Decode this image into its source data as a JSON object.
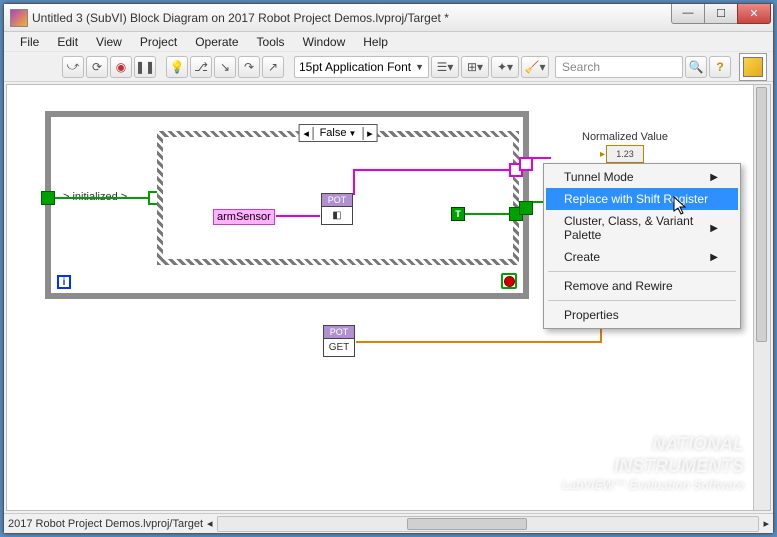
{
  "window": {
    "title": "Untitled 3 (SubVI) Block Diagram on 2017 Robot Project Demos.lvproj/Target *"
  },
  "menu": {
    "items": [
      "File",
      "Edit",
      "View",
      "Project",
      "Operate",
      "Tools",
      "Window",
      "Help"
    ]
  },
  "toolbar": {
    "font_label": "15pt Application Font",
    "search_placeholder": "Search"
  },
  "diagram": {
    "initialized_label": "> initialized >",
    "case_value": "False",
    "arm_sensor_const": "armSensor",
    "subvi_top_label": "POT",
    "subvi_bottom_label": "POT",
    "subvi_bottom_text": "GET",
    "bool_true": "T",
    "loop_iter": "i",
    "normalized_label": "Normalized Value",
    "normalized_box": "1.23"
  },
  "context_menu": {
    "items": [
      {
        "label": "Tunnel Mode",
        "submenu": true
      },
      {
        "label": "Replace with Shift Register",
        "selected": true
      },
      {
        "label": "Cluster, Class, & Variant Palette",
        "submenu": true
      },
      {
        "label": "Create",
        "submenu": true
      },
      {
        "sep": true
      },
      {
        "label": "Remove and Rewire"
      },
      {
        "sep": true
      },
      {
        "label": "Properties"
      }
    ]
  },
  "status": {
    "path": "2017 Robot Project Demos.lvproj/Target"
  },
  "watermark": {
    "line1": "NATIONAL",
    "line2": "INSTRUMENTS",
    "line3": "LabVIEW™ Evaluation Software"
  }
}
